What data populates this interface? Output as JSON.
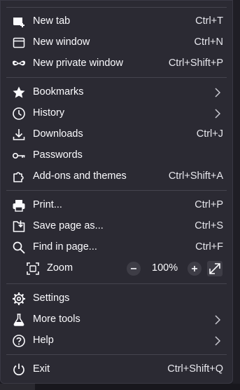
{
  "menu": {
    "new_tab": {
      "label": "New tab",
      "shortcut": "Ctrl+T",
      "icon": "new-tab-icon"
    },
    "new_window": {
      "label": "New window",
      "shortcut": "Ctrl+N",
      "icon": "new-window-icon"
    },
    "new_private_window": {
      "label": "New private window",
      "shortcut": "Ctrl+Shift+P",
      "icon": "private-mask-icon"
    },
    "bookmarks": {
      "label": "Bookmarks",
      "icon": "star-icon"
    },
    "history": {
      "label": "History",
      "icon": "clock-icon"
    },
    "downloads": {
      "label": "Downloads",
      "shortcut": "Ctrl+J",
      "icon": "download-icon"
    },
    "passwords": {
      "label": "Passwords",
      "icon": "key-icon"
    },
    "addons": {
      "label": "Add-ons and themes",
      "shortcut": "Ctrl+Shift+A",
      "icon": "puzzle-icon"
    },
    "print": {
      "label": "Print...",
      "shortcut": "Ctrl+P",
      "icon": "printer-icon"
    },
    "save_page": {
      "label": "Save page as...",
      "shortcut": "Ctrl+S",
      "icon": "save-icon"
    },
    "find": {
      "label": "Find in page...",
      "shortcut": "Ctrl+F",
      "icon": "search-icon"
    },
    "zoom": {
      "label": "Zoom",
      "value": "100%",
      "icon": "zoom-icon"
    },
    "settings": {
      "label": "Settings",
      "icon": "gear-icon"
    },
    "more_tools": {
      "label": "More tools",
      "icon": "flask-icon"
    },
    "help": {
      "label": "Help",
      "icon": "help-icon"
    },
    "exit": {
      "label": "Exit",
      "shortcut": "Ctrl+Shift+Q",
      "icon": "power-icon"
    }
  },
  "colors": {
    "background": "#2b2a33",
    "text": "#fbfbfe",
    "separator": "#45444e"
  }
}
